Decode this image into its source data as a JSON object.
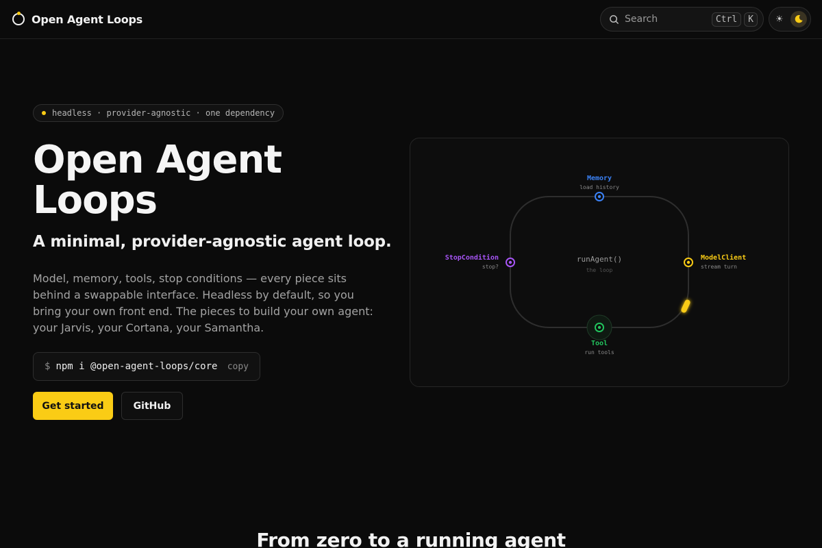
{
  "brand": {
    "name": "Open Agent Loops"
  },
  "search": {
    "label": "Search",
    "keys": [
      "Ctrl",
      "K"
    ]
  },
  "theme_toggle": {
    "active": "dark"
  },
  "hero": {
    "tagline": "headless · provider-agnostic · one dependency",
    "title": "Open Agent Loops",
    "subtitle": "A minimal, provider-agnostic agent loop.",
    "description": "Model, memory, tools, stop conditions — every piece sits behind a swappable interface. Headless by default, so you bring your own front end. The pieces to build your own agent: your Jarvis, your Cortana, your Samantha.",
    "install": {
      "prompt": "$",
      "command": "npm i @open-agent-loops/core",
      "copy_label": "copy"
    },
    "primary_button": "Get started",
    "secondary_button": "GitHub"
  },
  "diagram": {
    "center_title": "runAgent()",
    "center_sub": "the loop",
    "nodes": {
      "memory": {
        "label": "Memory",
        "sub": "load history",
        "color": "#3b82f6"
      },
      "model": {
        "label": "ModelClient",
        "sub": "stream turn",
        "color": "#facc15"
      },
      "tool": {
        "label": "Tool",
        "sub": "run tools",
        "color": "#22c55e"
      },
      "stop": {
        "label": "StopCondition",
        "sub": "stop?",
        "color": "#a855f7"
      }
    }
  },
  "next_section": {
    "heading": "From zero to a running agent"
  },
  "colors": {
    "accent": "#facc15",
    "background": "#0b0b0b"
  }
}
